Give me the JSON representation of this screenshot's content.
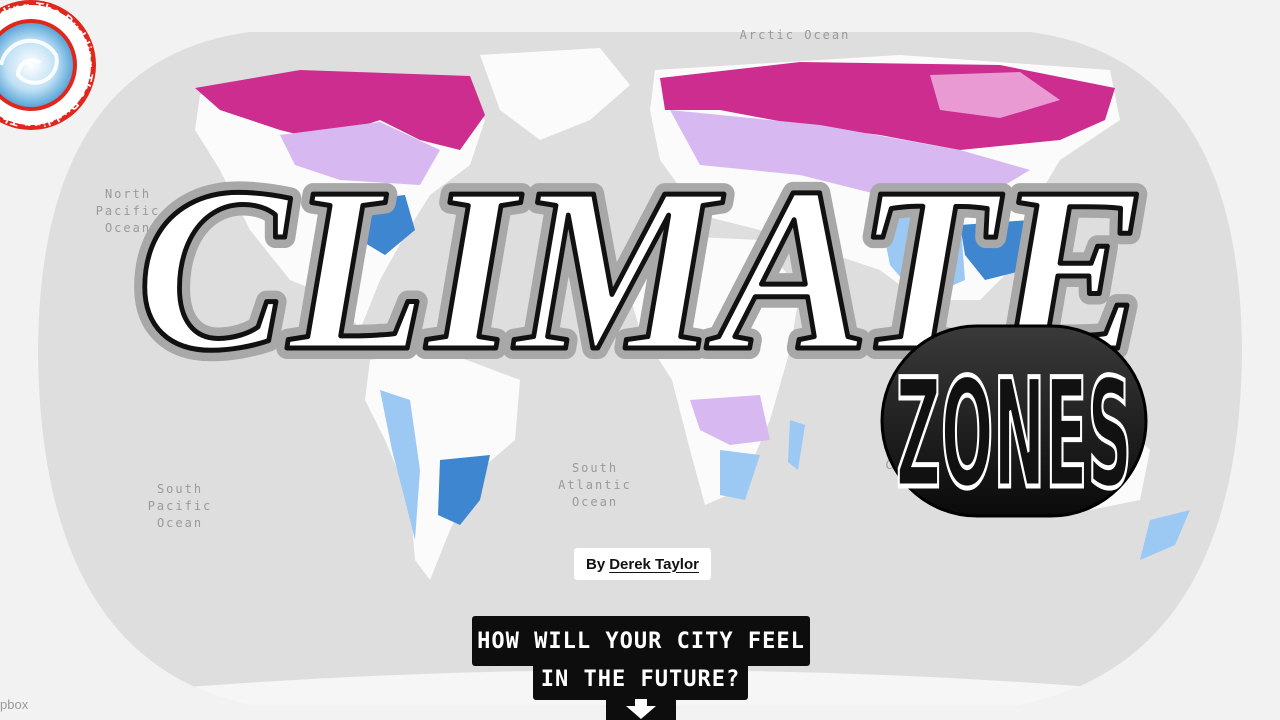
{
  "map": {
    "ocean_labels": {
      "arctic": "Arctic Ocean",
      "north_pacific": "North\nPacific\nOcean",
      "north_atlantic": "Oc",
      "south_pacific": "South\nPacific\nOcean",
      "south_atlantic": "South\nAtlantic\nOcean",
      "indian": "I\nC"
    },
    "attribution": "pbox",
    "colors": {
      "ocean": "#dedede",
      "land": "#fbfbfb",
      "magenta_zone": "#cc2d8e",
      "pink_zone": "#ea9ad2",
      "lavender_zone": "#d7b8f0",
      "lightblue_zone": "#9cc8f4",
      "blue_zone": "#3f86d0"
    }
  },
  "logo": {
    "ring_text": "The Pudding The Pudding The Pudding The Pudding ",
    "ring_color": "#e1261c"
  },
  "title": {
    "main": "CLIMATE",
    "badge": "ZONES"
  },
  "byline": {
    "prefix": "By",
    "author": "Derek Taylor"
  },
  "cta": {
    "line1": "HOW WILL YOUR CITY FEEL",
    "line2": "IN THE FUTURE?",
    "arrow_icon": "down-arrow-icon"
  }
}
